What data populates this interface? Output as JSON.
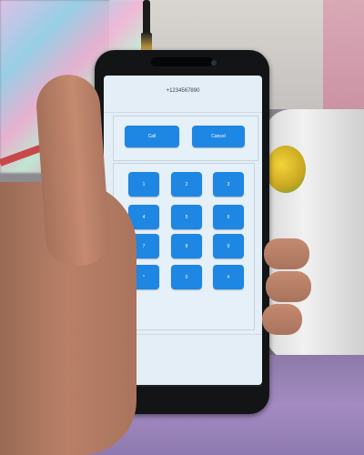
{
  "dialer": {
    "number": "+1234567890",
    "call_label": "Call",
    "cancel_label": "Cancel",
    "keys": [
      "1",
      "2",
      "3",
      "4",
      "5",
      "6",
      "7",
      "8",
      "9",
      "*",
      "0",
      "#"
    ]
  },
  "colors": {
    "button": "#1e86e3",
    "screen_bg": "#e4eef6",
    "phone_body": "#121416"
  }
}
